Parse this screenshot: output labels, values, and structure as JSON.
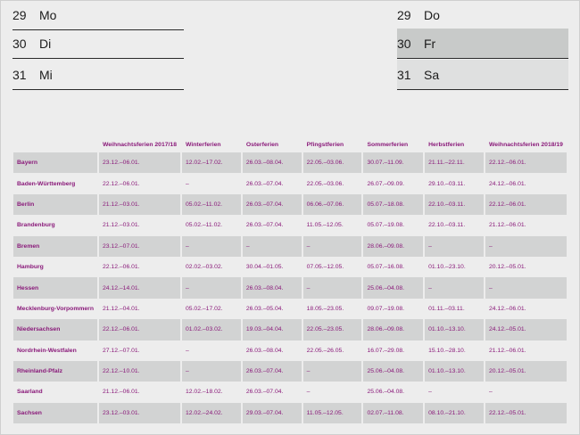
{
  "days_left": [
    {
      "num": "29",
      "weekday": "Mo"
    },
    {
      "num": "30",
      "weekday": "Di"
    },
    {
      "num": "31",
      "weekday": "Mi"
    }
  ],
  "days_right": [
    {
      "num": "29",
      "weekday": "Do",
      "shade": "none"
    },
    {
      "num": "30",
      "weekday": "Fr",
      "shade": "dark"
    },
    {
      "num": "31",
      "weekday": "Sa",
      "shade": "light"
    }
  ],
  "table": {
    "headers": [
      "",
      "Weihnachtsferien 2017/18",
      "Winterferien",
      "Osterferien",
      "Pfingstferien",
      "Sommerferien",
      "Herbstferien",
      "Weihnachtsferien 2018/19"
    ],
    "rows": [
      [
        "Bayern",
        "23.12.–06.01.",
        "12.02.–17.02.",
        "26.03.–08.04.",
        "22.05.–03.06.",
        "30.07.–11.09.",
        "21.11.–22.11.",
        "22.12.–06.01."
      ],
      [
        "Baden-Württemberg",
        "22.12.–06.01.",
        "–",
        "26.03.–07.04.",
        "22.05.–03.06.",
        "26.07.–09.09.",
        "29.10.–03.11.",
        "24.12.–06.01."
      ],
      [
        "Berlin",
        "21.12.–03.01.",
        "05.02.–11.02.",
        "26.03.–07.04.",
        "06.06.–07.06.",
        "05.07.–18.08.",
        "22.10.–03.11.",
        "22.12.–06.01."
      ],
      [
        "Brandenburg",
        "21.12.–03.01.",
        "05.02.–11.02.",
        "26.03.–07.04.",
        "11.05.–12.05.",
        "05.07.–19.08.",
        "22.10.–03.11.",
        "21.12.–06.01."
      ],
      [
        "Bremen",
        "23.12.–07.01.",
        "–",
        "–",
        "–",
        "28.06.–09.08.",
        "–",
        "–"
      ],
      [
        "Hamburg",
        "22.12.–06.01.",
        "02.02.–03.02.",
        "30.04.–01.05.",
        "07.05.–12.05.",
        "05.07.–16.08.",
        "01.10.–23.10.",
        "20.12.–05.01."
      ],
      [
        "Hessen",
        "24.12.–14.01.",
        "–",
        "26.03.–08.04.",
        "–",
        "25.06.–04.08.",
        "–",
        "–"
      ],
      [
        "Mecklenburg-Vorpommern",
        "21.12.–04.01.",
        "05.02.–17.02.",
        "26.03.–05.04.",
        "18.05.–23.05.",
        "09.07.–19.08.",
        "01.11.–03.11.",
        "24.12.–06.01."
      ],
      [
        "Niedersachsen",
        "22.12.–06.01.",
        "01.02.–03.02.",
        "19.03.–04.04.",
        "22.05.–23.05.",
        "28.06.–09.08.",
        "01.10.–13.10.",
        "24.12.–05.01."
      ],
      [
        "Nordrhein-Westfalen",
        "27.12.–07.01.",
        "–",
        "26.03.–08.04.",
        "22.05.–26.05.",
        "16.07.–29.08.",
        "15.10.–28.10.",
        "21.12.–06.01."
      ],
      [
        "Rheinland-Pfalz",
        "22.12.–10.01.",
        "–",
        "26.03.–07.04.",
        "–",
        "25.06.–04.08.",
        "01.10.–13.10.",
        "20.12.–05.01."
      ],
      [
        "Saarland",
        "21.12.–06.01.",
        "12.02.–18.02.",
        "26.03.–07.04.",
        "–",
        "25.06.–04.08.",
        "–",
        "–"
      ],
      [
        "Sachsen",
        "23.12.–03.01.",
        "12.02.–24.02.",
        "29.03.–07.04.",
        "11.05.–12.05.",
        "02.07.–11.08.",
        "08.10.–21.10.",
        "22.12.–05.01."
      ]
    ]
  },
  "colors": {
    "accent": "#8a1a7a",
    "row_shade": "#d2d3d3",
    "background": "#ededed"
  }
}
